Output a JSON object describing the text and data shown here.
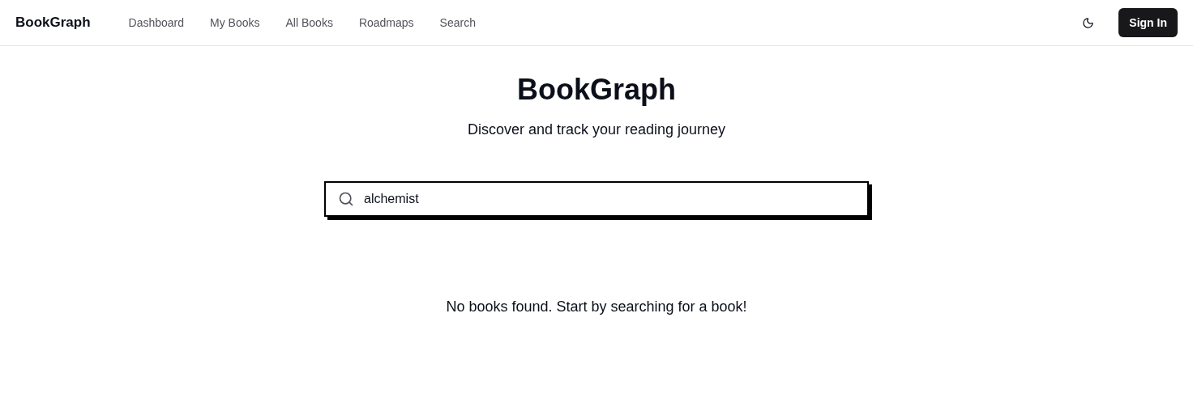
{
  "header": {
    "logo": "BookGraph",
    "nav": [
      {
        "label": "Dashboard"
      },
      {
        "label": "My Books"
      },
      {
        "label": "All Books"
      },
      {
        "label": "Roadmaps"
      },
      {
        "label": "Search"
      }
    ],
    "sign_in": "Sign In"
  },
  "hero": {
    "title": "BookGraph",
    "subtitle": "Discover and track your reading journey"
  },
  "search": {
    "value": "alchemist"
  },
  "empty_message": "No books found. Start by searching for a book!"
}
